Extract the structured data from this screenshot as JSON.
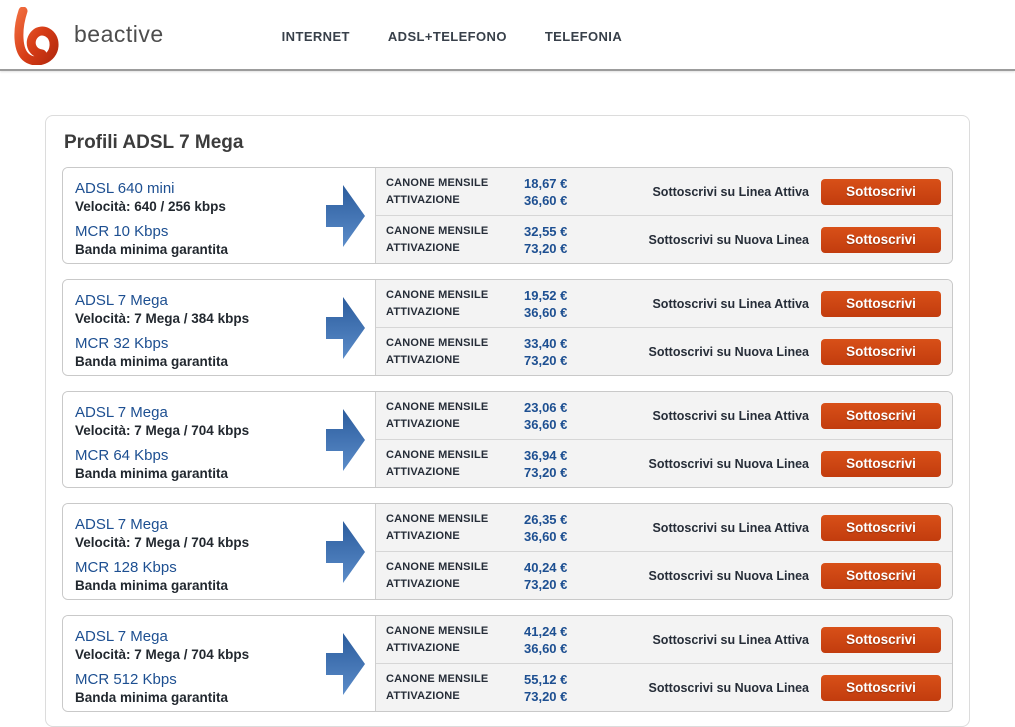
{
  "header": {
    "brand": "beactive",
    "nav": [
      {
        "label": "INTERNET"
      },
      {
        "label": "ADSL+TELEFONO"
      },
      {
        "label": "TELEFONIA"
      }
    ]
  },
  "page": {
    "title": "Profili ADSL 7 Mega"
  },
  "labels": {
    "canone": "CANONE MENSILE",
    "attivazione": "ATTIVAZIONE",
    "button": "Sottoscrivi"
  },
  "colors": {
    "accent_blue": "#1d4f91",
    "button_orange": "#cc4210",
    "arrow_gradient_top": "#2b5c9d",
    "arrow_gradient_bottom": "#5b8cc9",
    "logo_orange": "#d63c16"
  },
  "cards": [
    {
      "name": "ADSL 640 mini",
      "speed": "Velocità: 640 / 256 kbps",
      "mcr": "MCR 10 Kbps",
      "band": "Banda minima garantita",
      "offers": [
        {
          "canone": "18,67 €",
          "attivazione": "36,60 €",
          "subscribe_label": "Sottoscrivi su Linea Attiva"
        },
        {
          "canone": "32,55 €",
          "attivazione": "73,20 €",
          "subscribe_label": "Sottoscrivi su Nuova Linea"
        }
      ]
    },
    {
      "name": "ADSL 7 Mega",
      "speed": "Velocità: 7 Mega / 384 kbps",
      "mcr": "MCR 32 Kbps",
      "band": "Banda minima garantita",
      "offers": [
        {
          "canone": "19,52 €",
          "attivazione": "36,60 €",
          "subscribe_label": "Sottoscrivi su Linea Attiva"
        },
        {
          "canone": "33,40 €",
          "attivazione": "73,20 €",
          "subscribe_label": "Sottoscrivi su Nuova Linea"
        }
      ]
    },
    {
      "name": "ADSL 7 Mega",
      "speed": "Velocità: 7 Mega / 704 kbps",
      "mcr": "MCR 64 Kbps",
      "band": "Banda minima garantita",
      "offers": [
        {
          "canone": "23,06 €",
          "attivazione": "36,60 €",
          "subscribe_label": "Sottoscrivi su Linea Attiva"
        },
        {
          "canone": "36,94 €",
          "attivazione": "73,20 €",
          "subscribe_label": "Sottoscrivi su Nuova Linea"
        }
      ]
    },
    {
      "name": "ADSL 7 Mega",
      "speed": "Velocità: 7 Mega / 704 kbps",
      "mcr": "MCR 128 Kbps",
      "band": "Banda minima garantita",
      "offers": [
        {
          "canone": "26,35 €",
          "attivazione": "36,60 €",
          "subscribe_label": "Sottoscrivi su Linea Attiva"
        },
        {
          "canone": "40,24 €",
          "attivazione": "73,20 €",
          "subscribe_label": "Sottoscrivi su Nuova Linea"
        }
      ]
    },
    {
      "name": "ADSL 7 Mega",
      "speed": "Velocità: 7 Mega / 704 kbps",
      "mcr": "MCR 512 Kbps",
      "band": "Banda minima garantita",
      "offers": [
        {
          "canone": "41,24 €",
          "attivazione": "36,60 €",
          "subscribe_label": "Sottoscrivi su Linea Attiva"
        },
        {
          "canone": "55,12 €",
          "attivazione": "73,20 €",
          "subscribe_label": "Sottoscrivi su Nuova Linea"
        }
      ]
    }
  ]
}
